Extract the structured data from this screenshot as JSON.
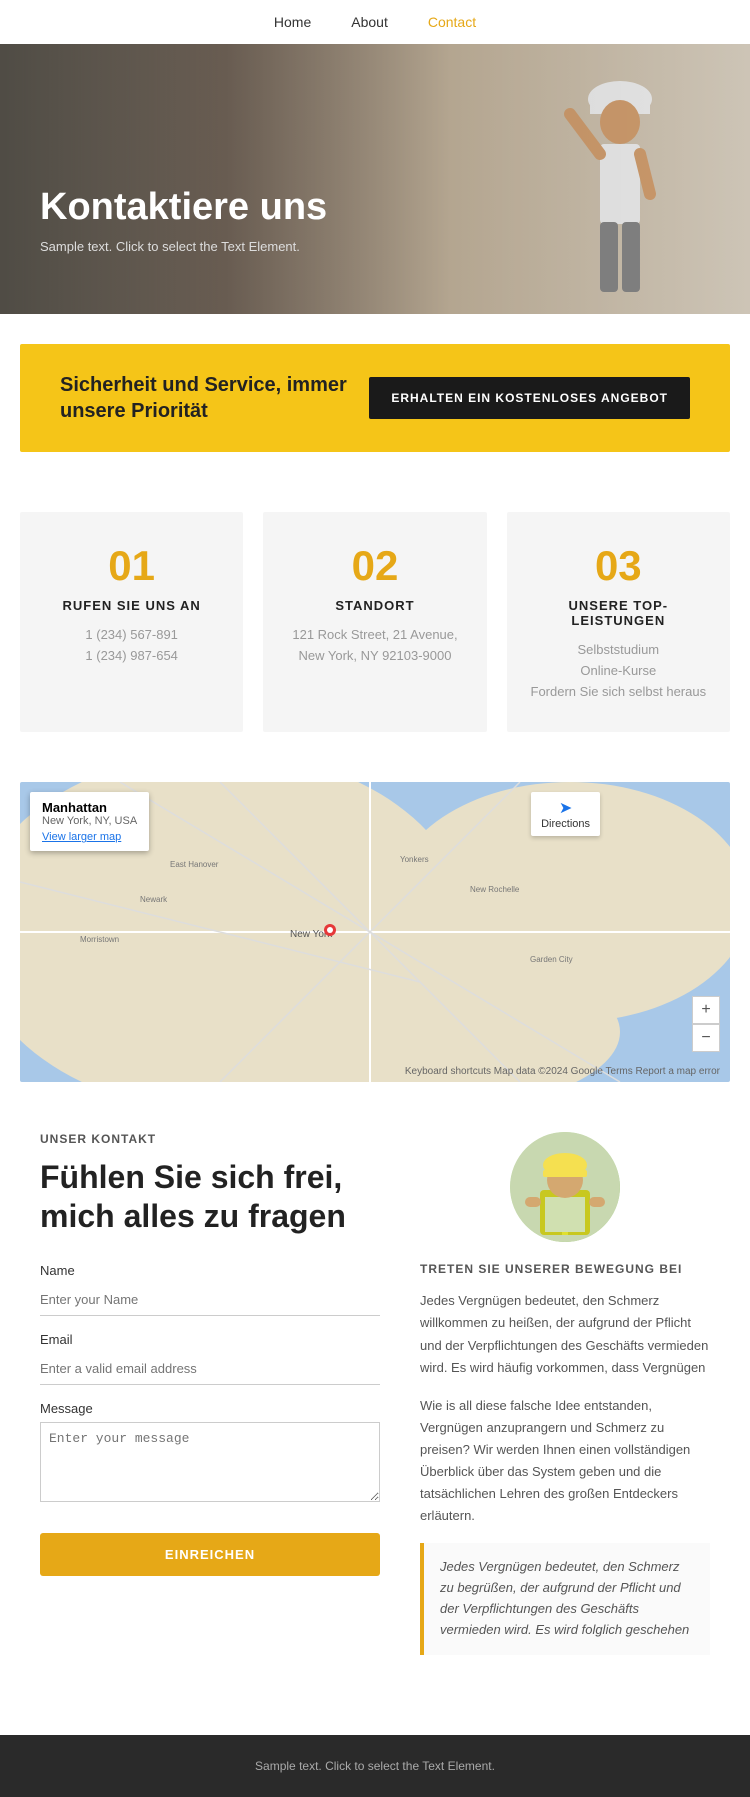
{
  "nav": {
    "items": [
      {
        "label": "Home",
        "active": false
      },
      {
        "label": "About",
        "active": false
      },
      {
        "label": "Contact",
        "active": true
      }
    ]
  },
  "hero": {
    "heading": "Kontaktiere uns",
    "subtext": "Sample text. Click to select the Text Element."
  },
  "banner": {
    "text": "Sicherheit und Service, immer unsere Priorität",
    "button": "ERHALTEN EIN KOSTENLOSES ANGEBOT"
  },
  "cards": [
    {
      "number": "01",
      "title": "RUFEN SIE UNS AN",
      "detail": "1 (234) 567-891\n1 (234) 987-654"
    },
    {
      "number": "02",
      "title": "STANDORT",
      "detail": "121 Rock Street, 21 Avenue,\nNew York, NY 92103-9000"
    },
    {
      "number": "03",
      "title": "UNSERE TOP-LEISTUNGEN",
      "detail": "Selbststudium\nOnline-Kurse\nFordern Sie sich selbst heraus"
    }
  ],
  "map": {
    "location": "Manhattan",
    "sublocation": "New York, NY, USA",
    "directions": "Directions",
    "view_larger": "View larger map",
    "zoom_in": "+",
    "zoom_out": "−",
    "credits": "Keyboard shortcuts  Map data ©2024 Google  Terms  Report a map error"
  },
  "contact": {
    "label": "UNSER KONTAKT",
    "heading": "Fühlen Sie sich frei,\nmich alles zu fragen",
    "form": {
      "name_label": "Name",
      "name_placeholder": "Enter your Name",
      "email_label": "Email",
      "email_placeholder": "Enter a valid email address",
      "message_label": "Message",
      "message_placeholder": "Enter your message",
      "submit": "EINREICHEN"
    }
  },
  "contact_right": {
    "join_label": "TRETEN SIE UNSERER BEWEGUNG BEI",
    "body1": "Jedes Vergnügen bedeutet, den Schmerz willkommen zu heißen, der aufgrund der Pflicht und der Verpflichtungen des Geschäfts vermieden wird. Es wird häufig vorkommen, dass Vergnügen",
    "body2": "Wie is all diese falsche Idee entstanden, Vergnügen anzuprangern und Schmerz zu preisen? Wir werden Ihnen einen vollständigen Überblick über das System geben und die tatsächlichen Lehren des großen Entdeckers erläutern.",
    "quote": "Jedes Vergnügen bedeutet, den Schmerz zu begrüßen, der aufgrund der Pflicht und der Verpflichtungen des Geschäfts vermieden wird. Es wird folglich geschehen"
  },
  "footer": {
    "text": "Sample text. Click to select the Text Element."
  }
}
